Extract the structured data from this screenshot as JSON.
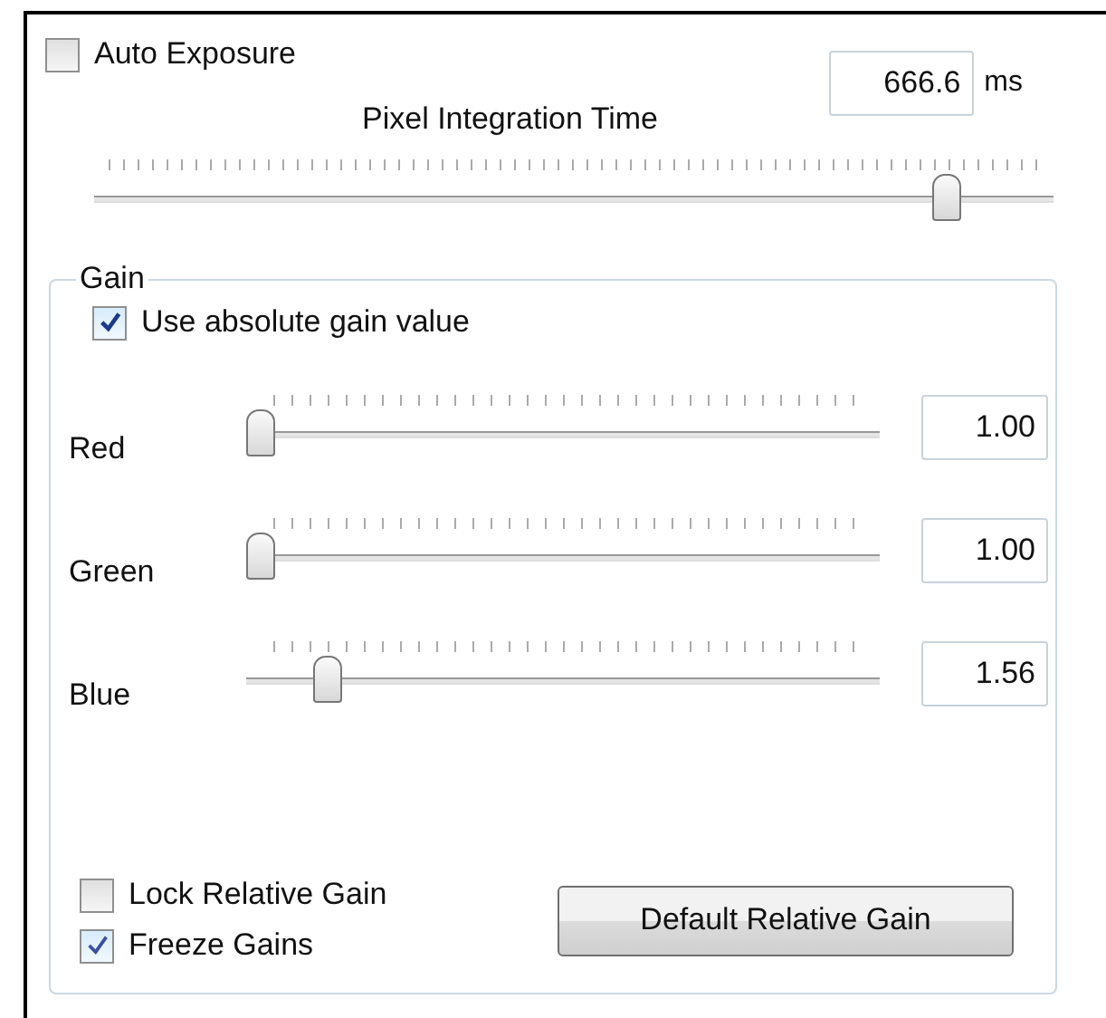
{
  "auto_exposure": {
    "label": "Auto Exposure",
    "checked": false
  },
  "integration_time": {
    "label": "Pixel Integration Time",
    "value": "666.6",
    "unit": "ms",
    "level": 0.9
  },
  "gain": {
    "title": "Gain",
    "use_absolute": {
      "label": "Use absolute gain value",
      "checked": true
    },
    "channels": [
      {
        "name": "Red",
        "level": 0,
        "value": "1.00"
      },
      {
        "name": "Green",
        "level": 0,
        "value": "1.00"
      },
      {
        "name": "Blue",
        "level": 0.11,
        "value": "1.56"
      }
    ],
    "options": [
      {
        "label": "Lock Relative Gain",
        "checked": false
      },
      {
        "label": "Freeze Gains",
        "checked": true
      }
    ],
    "button": "Default Relative Gain"
  }
}
